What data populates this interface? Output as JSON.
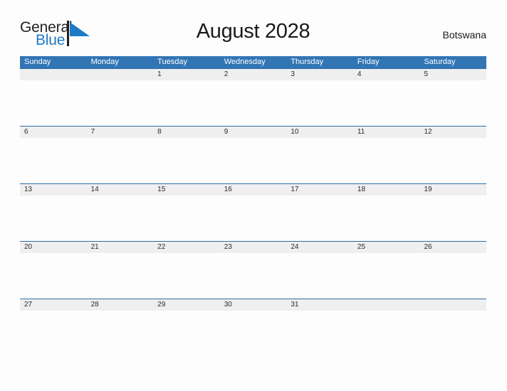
{
  "logo": {
    "word_one": "General",
    "word_two": "Blue",
    "flag_icon": "blue-flag-triangle-icon",
    "brand_blue": "#2079c4"
  },
  "header": {
    "title": "August 2028",
    "region": "Botswana"
  },
  "colors": {
    "header_blue": "#3175b5",
    "row_divider_blue": "#2d6ca2",
    "date_band_gray": "#efeff0",
    "page_background": "#fdfdfd"
  },
  "calendar": {
    "month": "August",
    "year": "2028",
    "weekday_headers": [
      "Sunday",
      "Monday",
      "Tuesday",
      "Wednesday",
      "Thursday",
      "Friday",
      "Saturday"
    ],
    "weeks": [
      {
        "days": [
          "",
          "",
          "1",
          "2",
          "3",
          "4",
          "5"
        ]
      },
      {
        "days": [
          "6",
          "7",
          "8",
          "9",
          "10",
          "11",
          "12"
        ]
      },
      {
        "days": [
          "13",
          "14",
          "15",
          "16",
          "17",
          "18",
          "19"
        ]
      },
      {
        "days": [
          "20",
          "21",
          "22",
          "23",
          "24",
          "25",
          "26"
        ]
      },
      {
        "days": [
          "27",
          "28",
          "29",
          "30",
          "31",
          "",
          ""
        ]
      }
    ]
  }
}
